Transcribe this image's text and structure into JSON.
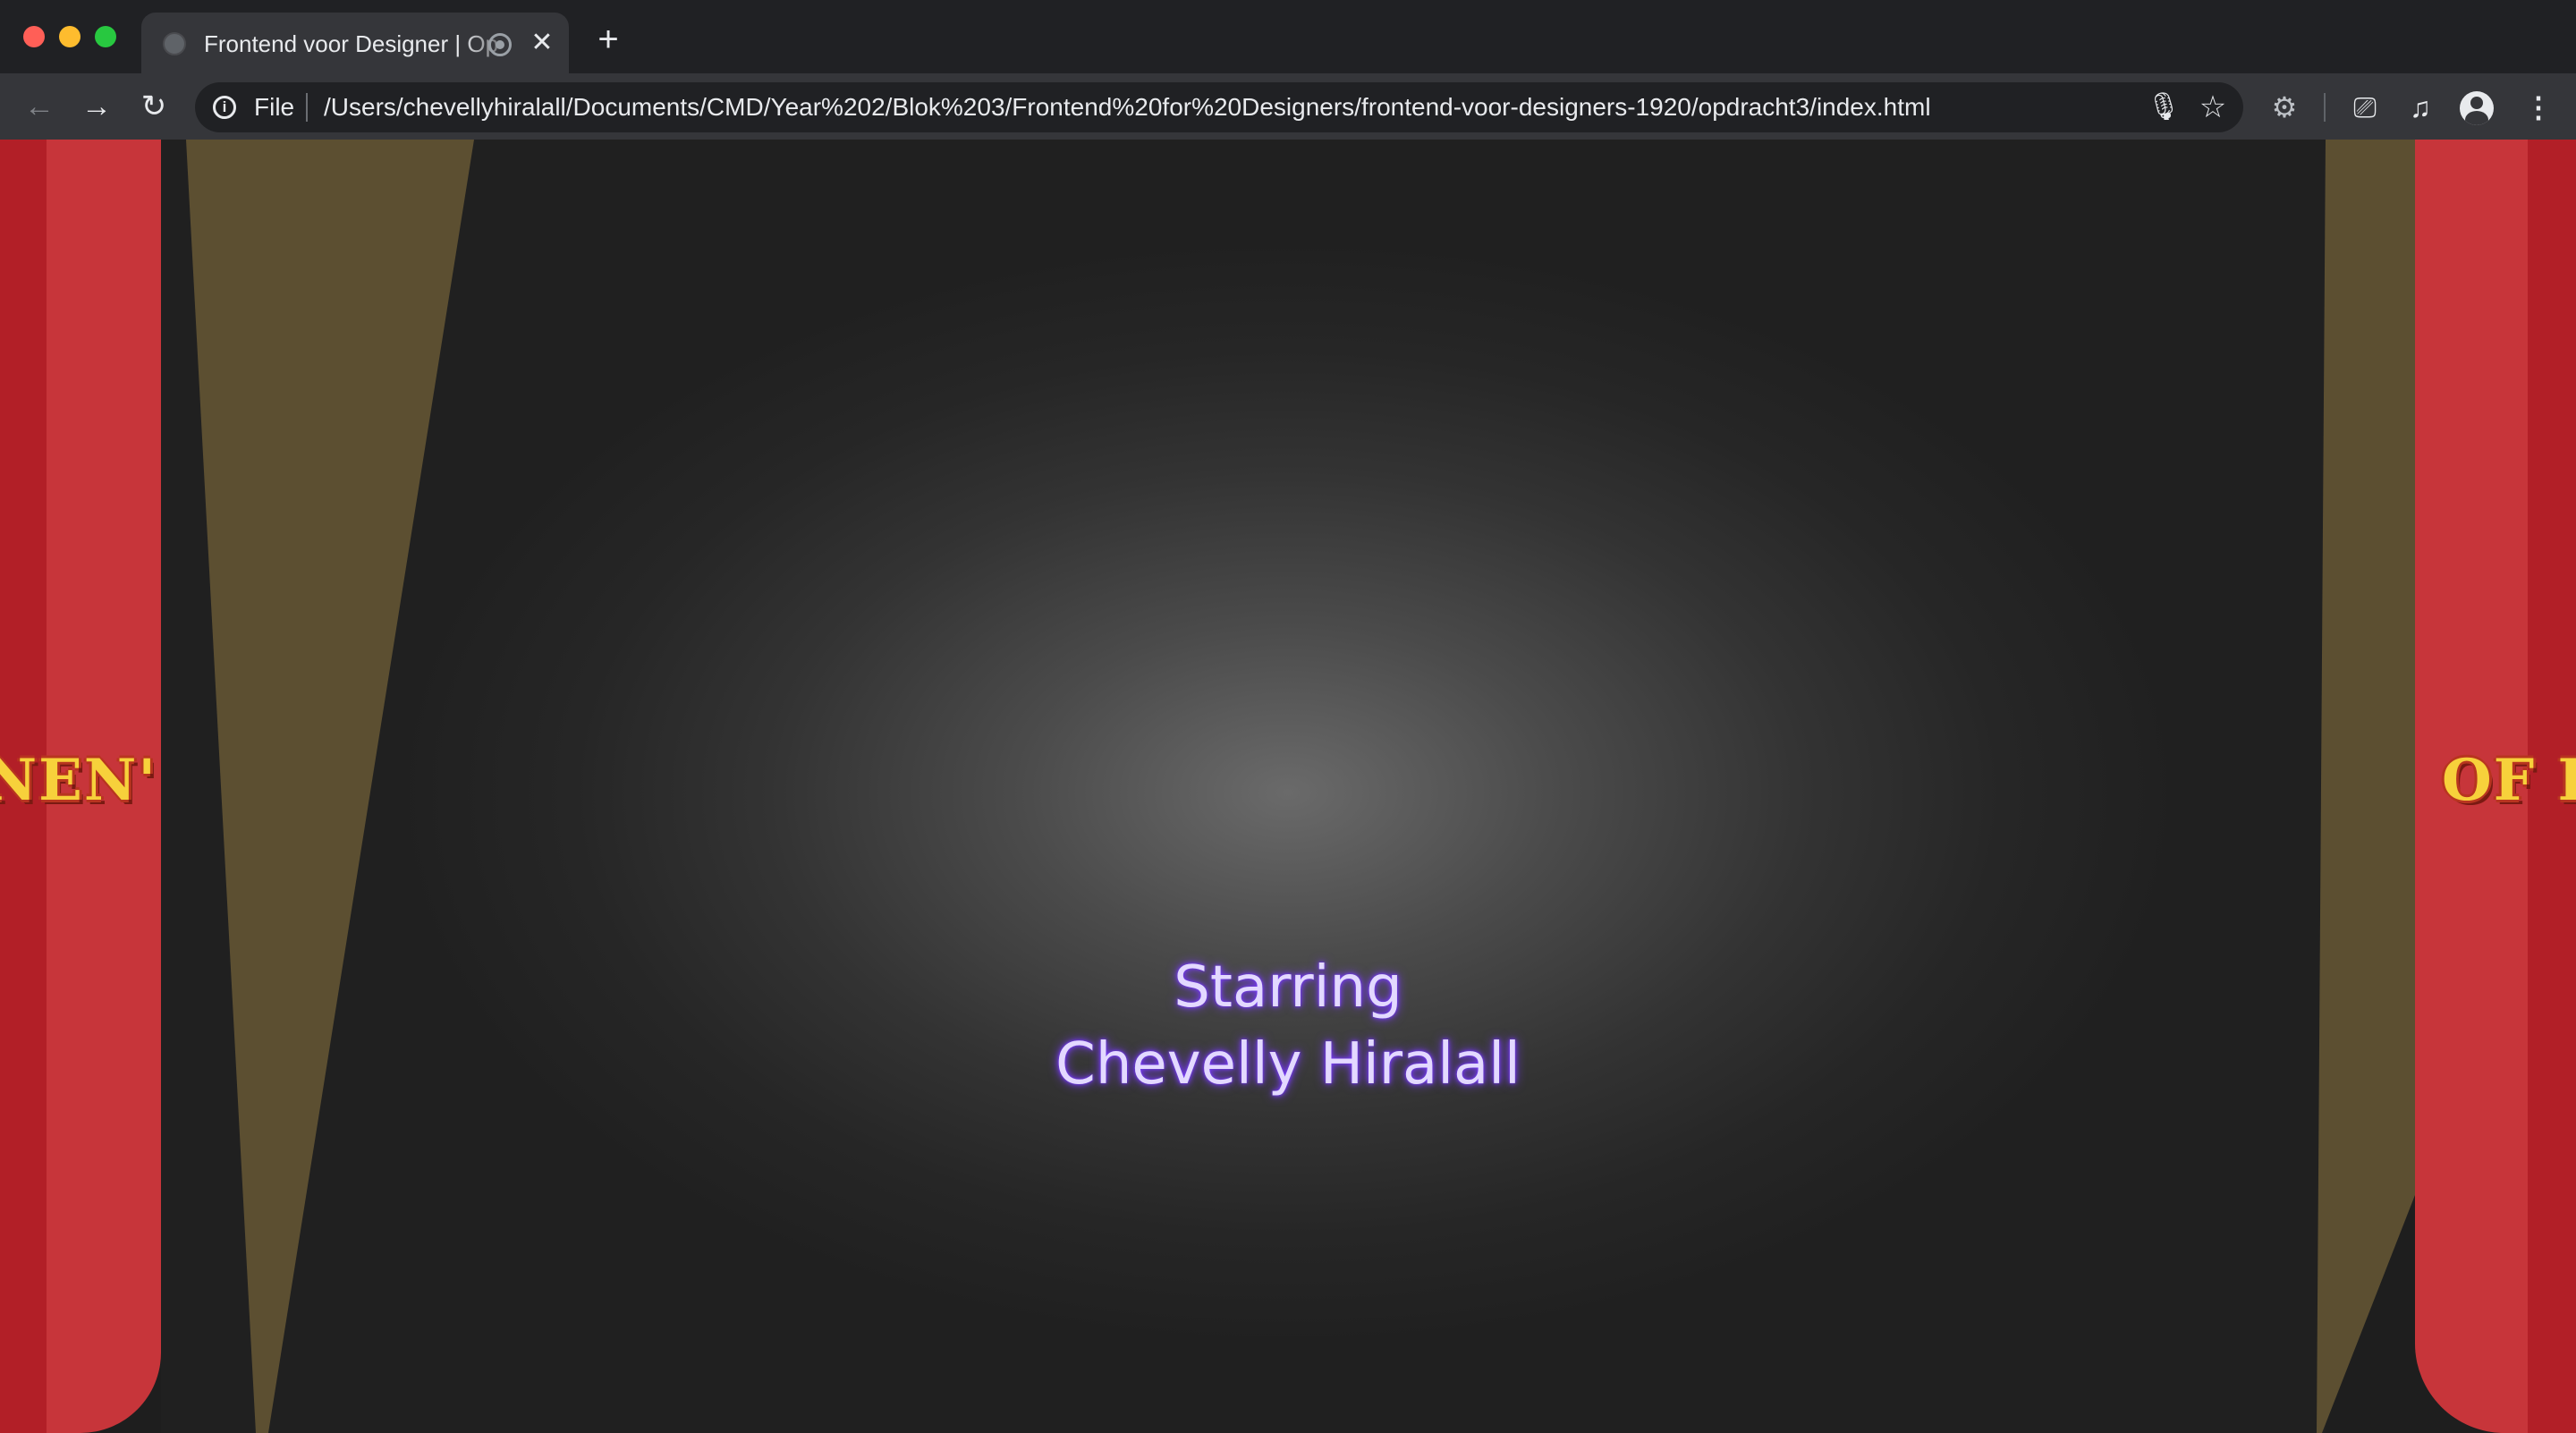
{
  "browser": {
    "tab": {
      "title": "Frontend voor Designer | Op",
      "close_glyph": "✕",
      "audio_icon": "record-icon"
    },
    "new_tab_glyph": "+",
    "nav": {
      "back_glyph": "←",
      "forward_glyph": "→",
      "reload_glyph": "↻"
    },
    "omnibox": {
      "info_glyph": "i",
      "scheme_label": "File",
      "url": "/Users/chevellyhiralall/Documents/CMD/Year%202/Blok%203/Frontend%20for%20Designers/frontend-voor-designers-1920/opdracht3/index.html",
      "mic_glyph": "🎙",
      "star_glyph": "☆"
    },
    "toolbar": {
      "extension_glyph": "⚙",
      "cast_glyph": "⎚",
      "media_glyph": "♫",
      "menu_glyph": "⋮"
    }
  },
  "page": {
    "curtain_left_text": "NEN'",
    "curtain_right_text": "OF F",
    "credits": {
      "line1": "Starring",
      "line2": "Chevelly Hiralall"
    }
  },
  "colors": {
    "curtain_red": "#c7353a",
    "curtain_dark_red": "#b21f27",
    "spotlight_beam": "#605233",
    "marquee_yellow": "#f7d13b",
    "credit_glow": "#7b3cff"
  }
}
